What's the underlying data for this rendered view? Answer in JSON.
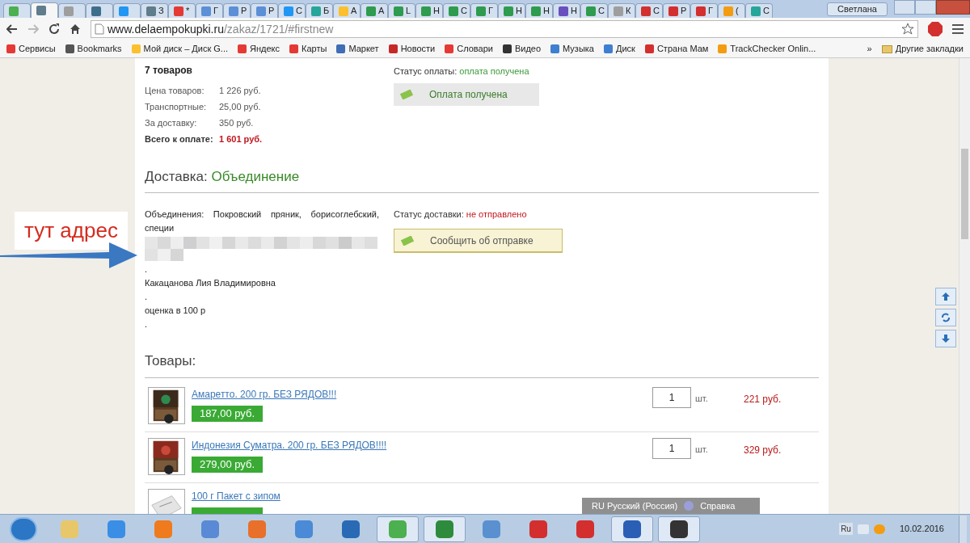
{
  "browser": {
    "tabs": [
      {
        "color": "#4caf50",
        "selected": false
      },
      {
        "color": "#607d8b",
        "selected": true
      },
      {
        "color": "#9e9e9e",
        "selected": false
      },
      {
        "color": "#3f6e8c",
        "selected": false
      },
      {
        "color": "#2196f3",
        "selected": false
      },
      {
        "label": "З",
        "color": "#607d8b",
        "selected": false
      },
      {
        "label": "*",
        "color": "#e53935",
        "selected": false
      },
      {
        "label": "Г",
        "color": "#5c8fd6",
        "selected": false
      },
      {
        "label": "Р",
        "color": "#5c8fd6",
        "selected": false
      },
      {
        "label": "Р",
        "color": "#5c8fd6",
        "selected": false
      },
      {
        "label": "С",
        "color": "#2196f3",
        "selected": false
      },
      {
        "label": "Б",
        "color": "#26a69a",
        "selected": false
      },
      {
        "label": "А",
        "color": "#fbc02d",
        "selected": false
      },
      {
        "label": "А",
        "color": "#2e9b4f",
        "selected": false
      },
      {
        "label": "L",
        "color": "#2e9b4f",
        "selected": false
      },
      {
        "label": "Н",
        "color": "#2e9b4f",
        "selected": false
      },
      {
        "label": "С",
        "color": "#2e9b4f",
        "selected": false
      },
      {
        "label": "Г",
        "color": "#2e9b4f",
        "selected": false
      },
      {
        "label": "Н",
        "color": "#2e9b4f",
        "selected": false
      },
      {
        "label": "Н",
        "color": "#2e9b4f",
        "selected": false
      },
      {
        "label": "Н",
        "color": "#6a4fbf",
        "selected": false
      },
      {
        "label": "С",
        "color": "#2e9b4f",
        "selected": false
      },
      {
        "label": "К",
        "color": "#9e9e9e",
        "selected": false
      },
      {
        "label": "С",
        "color": "#d32f2f",
        "selected": false
      },
      {
        "label": "Р",
        "color": "#d32f2f",
        "selected": false
      },
      {
        "label": "Г",
        "color": "#d32f2f",
        "selected": false
      },
      {
        "label": "(",
        "color": "#f39c12",
        "selected": false
      },
      {
        "label": "С",
        "color": "#26a69a",
        "selected": false
      }
    ],
    "user": "Светлана",
    "url_host": "www.delaempokupki.ru",
    "url_path": "/zakaz/1721/#firstnew",
    "bookmarks": [
      {
        "label": "Сервисы",
        "color": "#e53935"
      },
      {
        "label": "Bookmarks",
        "color": "#555555"
      },
      {
        "label": "Мой диск – Диск G...",
        "color": "#fbc02d"
      },
      {
        "label": "Яндекс",
        "color": "#e53935"
      },
      {
        "label": "Карты",
        "color": "#e53935"
      },
      {
        "label": "Маркет",
        "color": "#3f6eb5"
      },
      {
        "label": "Новости",
        "color": "#c62828"
      },
      {
        "label": "Словари",
        "color": "#e53935"
      },
      {
        "label": "Видео",
        "color": "#333333"
      },
      {
        "label": "Музыка",
        "color": "#3f7fd0"
      },
      {
        "label": "Диск",
        "color": "#3f7fd0"
      },
      {
        "label": "Страна Мам",
        "color": "#d32f2f"
      },
      {
        "label": "TrackChecker Onlin...",
        "color": "#f39c12"
      }
    ],
    "more": "»",
    "other_bookmarks": "Другие закладки"
  },
  "order": {
    "count": "7 товаров",
    "lines": [
      {
        "label": "Цена товаров:",
        "value": "1 226 руб."
      },
      {
        "label": "Транспортные:",
        "value": "25,00 руб."
      },
      {
        "label": "За доставку:",
        "value": "350 руб."
      }
    ],
    "total_label": "Всего к оплате:",
    "total_value": "1 601 руб.",
    "payment_status_label": "Статус оплаты:",
    "payment_status": "оплата получена",
    "payment_button": "Оплата получена"
  },
  "delivery": {
    "heading": "Доставка:",
    "method": "Объединение",
    "lines": [
      "Объединения: Покровский пряник, борисоглебский, специи",
      ".",
      "Какацанова Лия Владимировна",
      ".",
      "оценка в 100 р",
      "."
    ],
    "status_label": "Статус доставки:",
    "status": "не отправлено",
    "button": "Сообщить об отправке"
  },
  "products": {
    "heading": "Товары:",
    "rows": [
      {
        "name": "Амаретто. 200 гр. БЕЗ РЯДОВ!!!",
        "price": "187,00 руб.",
        "qty": "1",
        "unit": "шт.",
        "total": "221 руб."
      },
      {
        "name": "Индонезия Суматра. 200 гр. БЕЗ РЯДОВ!!!!",
        "price": "279,00 руб.",
        "qty": "1",
        "unit": "шт.",
        "total": "329 руб."
      },
      {
        "name": "100 г Пакет с зипом"
      }
    ]
  },
  "annotation": "тут адрес",
  "language_bar": {
    "lang": "RU Русский (Россия)",
    "help": "Справка"
  },
  "tray": {
    "lang": "Ru",
    "date": "10.02.2016"
  }
}
